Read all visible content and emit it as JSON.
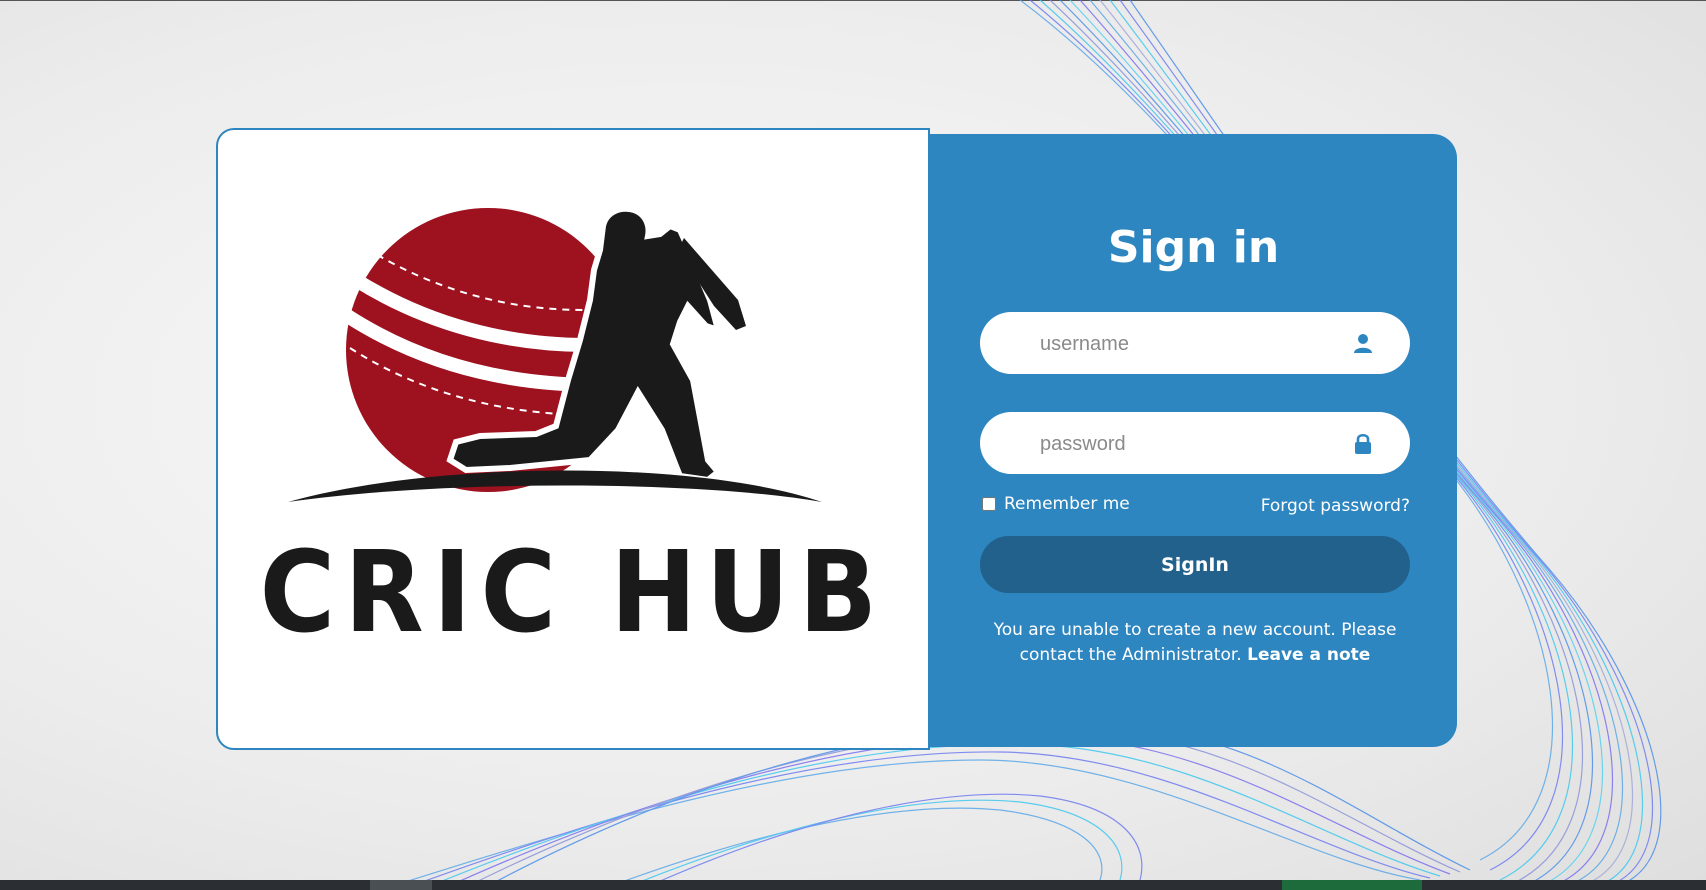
{
  "logo": {
    "text": "CRIC HUB",
    "ball_color": "#9e111f",
    "silhouette_color": "#1a1a1a"
  },
  "signin": {
    "title": "Sign in",
    "username_placeholder": "username",
    "password_placeholder": "password",
    "remember_label": "Remember me",
    "forgot_label": "Forgot password?",
    "button_label": "SignIn",
    "note_text": "You are unable to create a new account. Please contact the Administrator.",
    "note_link": "Leave a note",
    "panel_color": "#2e86c1",
    "button_color": "#21618c"
  },
  "icons": {
    "username": "user-icon",
    "password": "lock-icon"
  }
}
